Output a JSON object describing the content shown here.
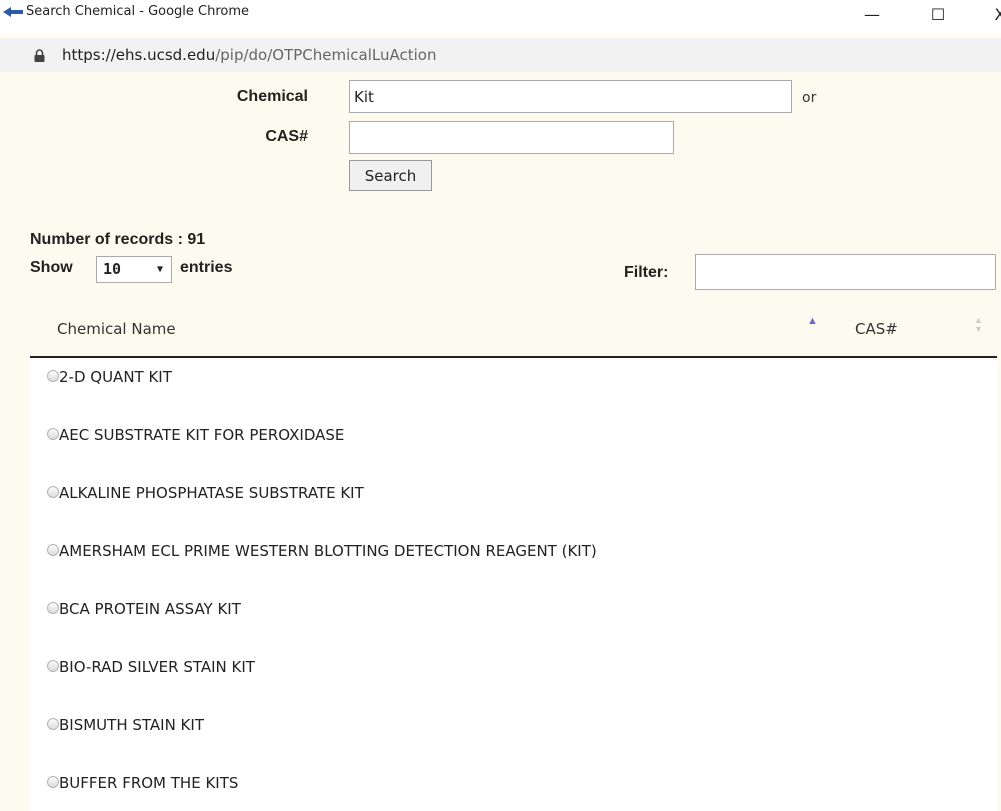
{
  "window": {
    "title": "Search Chemical - Google Chrome",
    "minimize_glyph": "—",
    "maximize_glyph": "☐",
    "close_glyph": "X"
  },
  "address": {
    "host": "https://ehs.ucsd.edu",
    "path": "/pip/do/OTPChemicalLuAction"
  },
  "form": {
    "chemical_label": "Chemical",
    "chemical_value": "Kit",
    "or_text": "or",
    "cas_label": "CAS#",
    "cas_value": "",
    "search_label": "Search"
  },
  "records": {
    "count_text": "Number of records : 91",
    "show_label": "Show",
    "entries_value": "10",
    "entries_label": "entries",
    "filter_label": "Filter:",
    "filter_value": ""
  },
  "table": {
    "columns": [
      "Chemical Name",
      "CAS#"
    ],
    "sort_asc_glyph": "▲",
    "sort_up_glyph": "▲",
    "sort_down_glyph": "▼",
    "rows": [
      "2-D QUANT KIT",
      "AEC SUBSTRATE KIT FOR PEROXIDASE",
      "ALKALINE PHOSPHATASE SUBSTRATE KIT",
      "AMERSHAM ECL PRIME WESTERN BLOTTING DETECTION REAGENT (KIT)",
      "BCA PROTEIN ASSAY KIT",
      "BIO-RAD SILVER STAIN KIT",
      "BISMUTH STAIN KIT",
      "BUFFER FROM THE KITS"
    ]
  },
  "colors": {
    "page_background": "#fdfbef",
    "sort_active": "#6b6bd6"
  }
}
